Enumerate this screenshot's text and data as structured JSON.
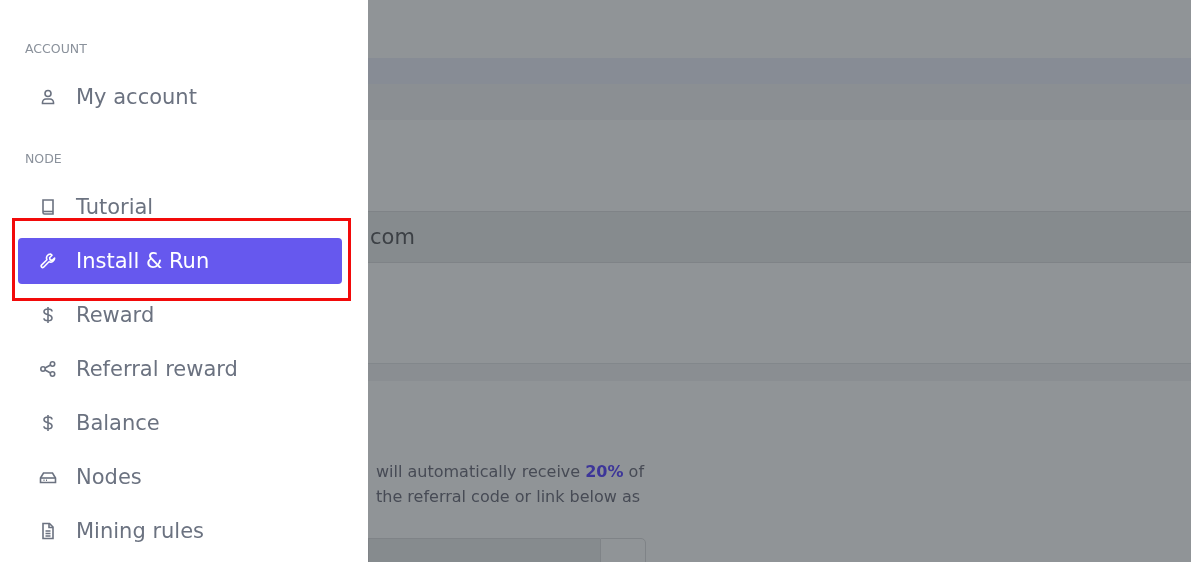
{
  "sidebar": {
    "sections": [
      {
        "heading": "ACCOUNT",
        "items": [
          {
            "label": "My account",
            "kind": "person",
            "selected": false,
            "highlighted": false
          }
        ]
      },
      {
        "heading": "NODE",
        "items": [
          {
            "label": "Tutorial",
            "kind": "book",
            "selected": false,
            "highlighted": false
          },
          {
            "label": "Install & Run",
            "kind": "wrench",
            "selected": true,
            "highlighted": true
          },
          {
            "label": "Reward",
            "kind": "dollar",
            "selected": false,
            "highlighted": false
          },
          {
            "label": "Referral reward",
            "kind": "share",
            "selected": false,
            "highlighted": false
          },
          {
            "label": "Balance",
            "kind": "dollar",
            "selected": false,
            "highlighted": false
          },
          {
            "label": "Nodes",
            "kind": "drive",
            "selected": false,
            "highlighted": false
          },
          {
            "label": "Mining rules",
            "kind": "document",
            "selected": false,
            "highlighted": false
          }
        ]
      }
    ]
  },
  "background_page": {
    "field_value": "com",
    "paragraph_lines": [
      "will automatically receive **20%** of",
      "the referral code or link below as"
    ]
  }
}
